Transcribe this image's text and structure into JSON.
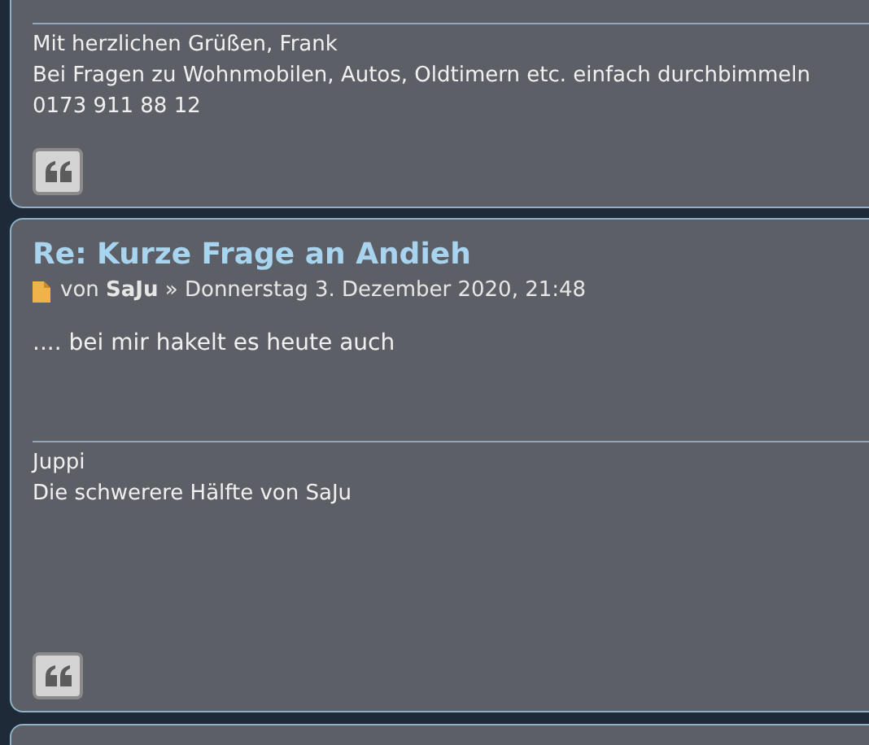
{
  "posts": [
    {
      "signature": [
        "Mit herzlichen Grüßen, Frank",
        "Bei Fragen zu Wohnmobilen, Autos, Oldtimern etc. einfach durchbimmeln",
        "0173 911 88 12"
      ]
    },
    {
      "title": "Re: Kurze Frage an Andieh",
      "by": "von",
      "author": "SaJu",
      "date": "» Donnerstag 3. Dezember 2020, 21:48",
      "body": ".... bei mir hakelt es heute auch",
      "signature": [
        "Juppi",
        "Die schwerere Hälfte von SaJu"
      ]
    }
  ]
}
